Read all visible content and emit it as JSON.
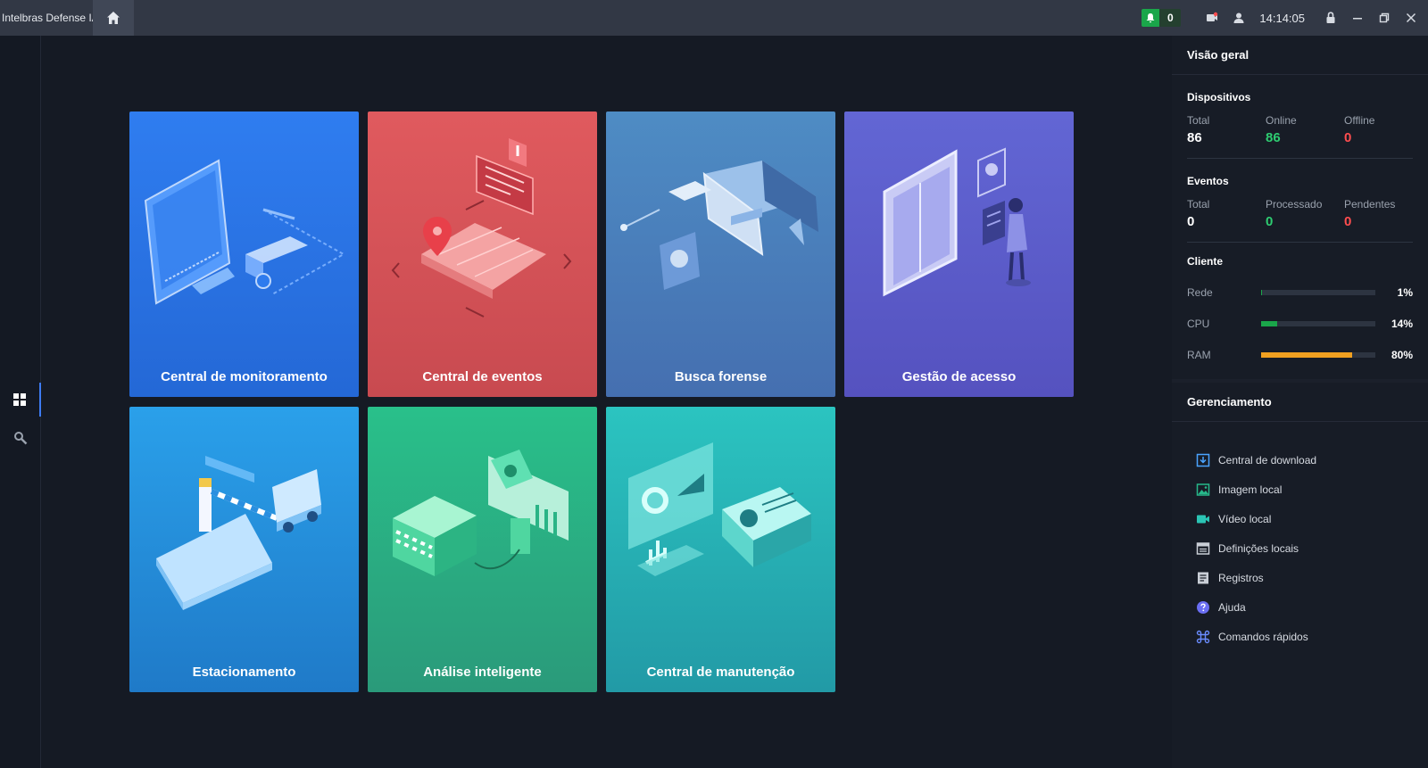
{
  "window": {
    "title": "Intelbras Defense IA",
    "notification_count": "0",
    "clock": "14:14:05"
  },
  "tiles": [
    {
      "label": "Central de monitoramento"
    },
    {
      "label": "Central de eventos"
    },
    {
      "label": "Busca forense"
    },
    {
      "label": "Gestão de acesso"
    },
    {
      "label": "Estacionamento"
    },
    {
      "label": "Análise inteligente"
    },
    {
      "label": "Central de manutenção"
    }
  ],
  "overview": {
    "title": "Visão geral",
    "devices": {
      "title": "Dispositivos",
      "total_label": "Total",
      "total": "86",
      "online_label": "Online",
      "online": "86",
      "offline_label": "Offline",
      "offline": "0"
    },
    "events": {
      "title": "Eventos",
      "total_label": "Total",
      "total": "0",
      "processed_label": "Processado",
      "processed": "0",
      "pending_label": "Pendentes",
      "pending": "0"
    },
    "client": {
      "title": "Cliente",
      "resources": [
        {
          "label": "Rede",
          "value": "1%",
          "fraction": 0.01,
          "color": "#1aa64a"
        },
        {
          "label": "CPU",
          "value": "14%",
          "fraction": 0.14,
          "color": "#1aa64a"
        },
        {
          "label": "RAM",
          "value": "80%",
          "fraction": 0.8,
          "color": "#f0a020"
        }
      ]
    }
  },
  "management": {
    "title": "Gerenciamento",
    "items": [
      {
        "label": "Central de download",
        "icon": "download-icon"
      },
      {
        "label": "Imagem local",
        "icon": "image-icon"
      },
      {
        "label": "Vídeo local",
        "icon": "video-icon"
      },
      {
        "label": "Definições locais",
        "icon": "settings-icon"
      },
      {
        "label": "Registros",
        "icon": "log-icon"
      },
      {
        "label": "Ajuda",
        "icon": "help-icon"
      },
      {
        "label": "Comandos rápidos",
        "icon": "command-icon"
      }
    ]
  },
  "colors": {
    "online": "#2ecc71",
    "offline": "#ff4d4f",
    "accent": "#3d7bf2"
  }
}
